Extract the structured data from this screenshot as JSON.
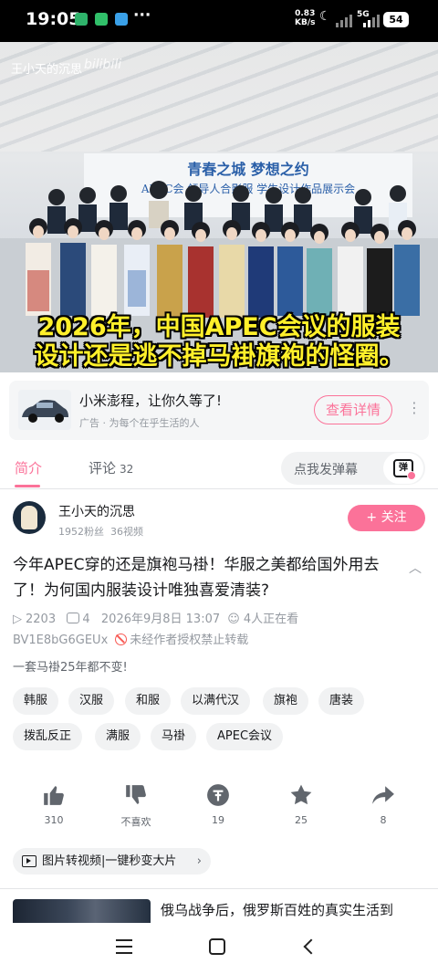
{
  "status_bar": {
    "time": "19:05",
    "more": "···",
    "net_speed_value": "0.83",
    "net_speed_unit": "KB/s",
    "network": "5G",
    "battery": "54"
  },
  "video": {
    "channel_watermark": "王小天的沉思",
    "banner_line1": "青春之城 梦想之约",
    "banner_line2": "APEC会 领导人合影服 学生设计作品展示会",
    "caption_line1": "2026年，中国APEC会议的服装",
    "caption_line2": "设计还是逃不掉马褂旗袍的怪圈。"
  },
  "ad": {
    "title": "小米澎程，让你久等了!",
    "tag": "广告 · 为每个在乎生活的人",
    "button": "查看详情"
  },
  "tabs": [
    {
      "label": "简介",
      "count": ""
    },
    {
      "label": "评论",
      "count": "32"
    }
  ],
  "danmaku": {
    "placeholder": "点我发弹幕",
    "button_glyph": "弹"
  },
  "author": {
    "name": "王小天的沉思",
    "fans": "1952粉丝",
    "videos": "36视频",
    "follow": "+ 关注"
  },
  "video_info": {
    "title": "今年APEC穿的还是旗袍马褂！华服之美都给国外用去了！为何国内服装设计唯独喜爱清装?",
    "plays": "2203",
    "danmaku_count": "4",
    "date": "2026年9月8日 13:07",
    "watching": "4人正在看",
    "bvid": "BV1E8bG6GEUx",
    "copyright": "未经作者授权禁止转载",
    "description": "一套马褂25年都不变!"
  },
  "tags": [
    "韩服",
    "汉服",
    "和服",
    "以满代汉",
    "旗袍",
    "唐装",
    "拨乱反正",
    "满服",
    "马褂",
    "APEC会议"
  ],
  "actions": [
    {
      "name": "like",
      "label": "310"
    },
    {
      "name": "dislike",
      "label": "不喜欢"
    },
    {
      "name": "coin",
      "label": "19"
    },
    {
      "name": "favorite",
      "label": "25"
    },
    {
      "name": "share",
      "label": "8"
    }
  ],
  "promo": {
    "label": "图片转视频|一键秒变大片",
    "arrow": "›"
  },
  "recommendation": {
    "title": "俄乌战争后，俄罗斯百姓的真实生活到"
  }
}
